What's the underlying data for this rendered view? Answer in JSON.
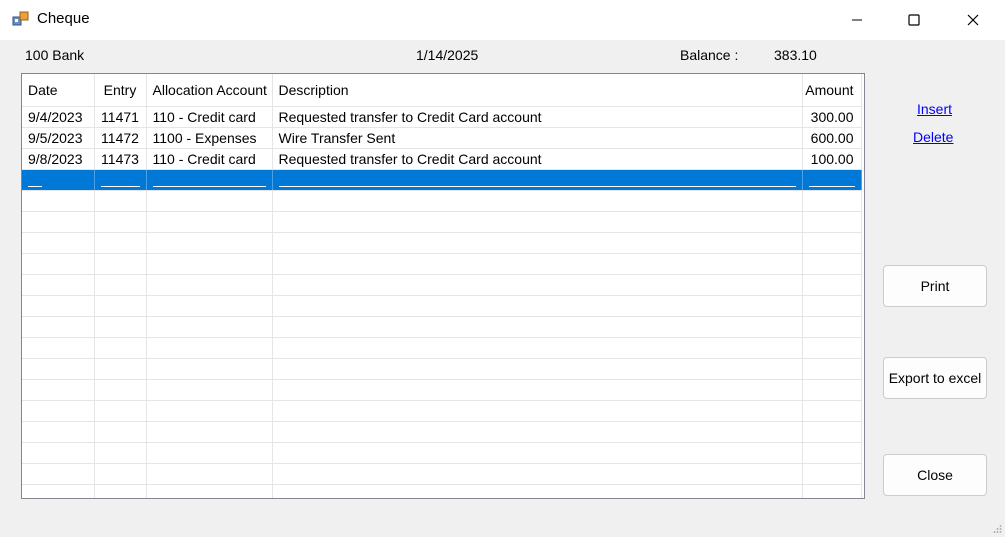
{
  "window": {
    "title": "Cheque"
  },
  "header": {
    "bank": "100 Bank",
    "date": "1/14/2025",
    "balance_label": "Balance :",
    "balance_value": "383.10"
  },
  "grid": {
    "columns": [
      "Date",
      "Entry",
      "Allocation Account",
      "Description",
      "Amount"
    ],
    "rows": [
      {
        "date": "9/4/2023",
        "entry": "11471",
        "account": "110 - Credit card",
        "description": "Requested transfer to Credit Card account",
        "amount": "300.00"
      },
      {
        "date": "9/5/2023",
        "entry": "11472",
        "account": "1100 - Expenses",
        "description": "Wire Transfer Sent",
        "amount": "600.00"
      },
      {
        "date": "9/8/2023",
        "entry": "11473",
        "account": "110 - Credit card",
        "description": "Requested transfer to Credit Card account",
        "amount": "100.00"
      }
    ]
  },
  "actions": {
    "insert": "Insert",
    "delete": "Delete",
    "print": "Print",
    "export": "Export to excel",
    "close": "Close"
  },
  "icons": {
    "app": "app-icon",
    "minimize": "minimize-icon",
    "maximize": "maximize-icon",
    "close": "close-icon"
  },
  "colors": {
    "selection": "#0078d7",
    "link": "#0000ff"
  }
}
